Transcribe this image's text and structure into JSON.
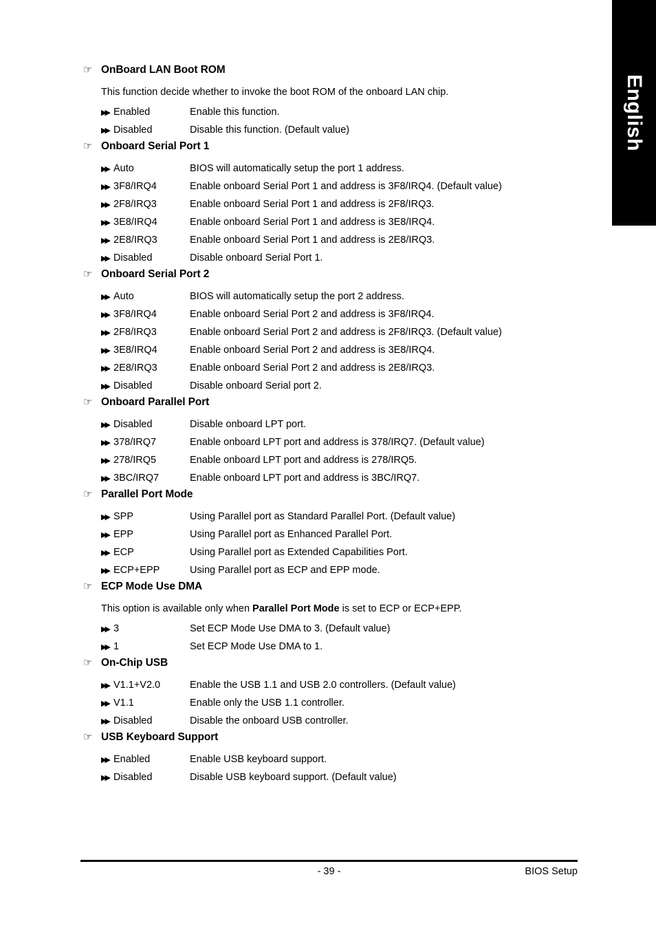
{
  "language_tab": {
    "label": "English"
  },
  "icons": {
    "section_marker": "☞",
    "option_marker": "▶▶"
  },
  "footer": {
    "page_number": "- 39 -",
    "document_name": "BIOS Setup"
  },
  "sections": [
    {
      "title": "OnBoard LAN Boot ROM",
      "note": "This function decide whether to invoke the boot ROM of the onboard LAN chip.",
      "note_bold": null,
      "options": [
        {
          "key": "Enabled",
          "desc": "Enable this function."
        },
        {
          "key": "Disabled",
          "desc": "Disable this function. (Default value)"
        }
      ]
    },
    {
      "title": "Onboard Serial Port 1",
      "note": null,
      "options": [
        {
          "key": "Auto",
          "desc": "BIOS will automatically setup the port 1 address."
        },
        {
          "key": "3F8/IRQ4",
          "desc": "Enable onboard Serial Port 1 and address is 3F8/IRQ4. (Default value)"
        },
        {
          "key": "2F8/IRQ3",
          "desc": "Enable onboard Serial Port 1 and address is 2F8/IRQ3."
        },
        {
          "key": "3E8/IRQ4",
          "desc": "Enable onboard Serial Port 1 and address is 3E8/IRQ4."
        },
        {
          "key": "2E8/IRQ3",
          "desc": "Enable onboard Serial Port 1 and address is 2E8/IRQ3."
        },
        {
          "key": "Disabled",
          "desc": "Disable onboard Serial Port 1."
        }
      ]
    },
    {
      "title": "Onboard Serial Port 2",
      "note": null,
      "options": [
        {
          "key": "Auto",
          "desc": "BIOS will automatically setup the port 2 address."
        },
        {
          "key": "3F8/IRQ4",
          "desc": "Enable onboard Serial Port 2 and address is 3F8/IRQ4."
        },
        {
          "key": "2F8/IRQ3",
          "desc": "Enable onboard Serial Port 2 and address is 2F8/IRQ3. (Default value)"
        },
        {
          "key": "3E8/IRQ4",
          "desc": "Enable onboard Serial Port 2 and address is 3E8/IRQ4."
        },
        {
          "key": "2E8/IRQ3",
          "desc": "Enable onboard Serial Port 2 and address is 2E8/IRQ3."
        },
        {
          "key": "Disabled",
          "desc": "Disable onboard Serial port 2."
        }
      ]
    },
    {
      "title": "Onboard Parallel Port",
      "note": null,
      "options": [
        {
          "key": "Disabled",
          "desc": "Disable onboard LPT port."
        },
        {
          "key": "378/IRQ7",
          "desc": "Enable onboard LPT port and address is 378/IRQ7. (Default value)"
        },
        {
          "key": "278/IRQ5",
          "desc": "Enable onboard LPT port and address is 278/IRQ5."
        },
        {
          "key": "3BC/IRQ7",
          "desc": "Enable onboard LPT port and address is 3BC/IRQ7."
        }
      ]
    },
    {
      "title": "Parallel Port Mode",
      "note": null,
      "options": [
        {
          "key": "SPP",
          "desc": "Using Parallel port as Standard Parallel Port. (Default value)"
        },
        {
          "key": "EPP",
          "desc": "Using Parallel port as Enhanced Parallel Port."
        },
        {
          "key": "ECP",
          "desc": "Using Parallel port as Extended Capabilities Port."
        },
        {
          "key": "ECP+EPP",
          "desc": "Using Parallel port as ECP and EPP mode."
        }
      ]
    },
    {
      "title": "ECP Mode Use DMA",
      "note_pre": "This option is available only when ",
      "note_bold": "Parallel Port Mode",
      "note_post": " is set to ECP or ECP+EPP.",
      "options": [
        {
          "key": "3",
          "desc": "Set ECP Mode Use DMA to 3. (Default value)"
        },
        {
          "key": "1",
          "desc": "Set ECP Mode Use DMA to 1."
        }
      ]
    },
    {
      "title": "On-Chip USB",
      "note": null,
      "options": [
        {
          "key": "V1.1+V2.0",
          "desc": "Enable the USB 1.1 and USB 2.0 controllers. (Default value)"
        },
        {
          "key": "V1.1",
          "desc": "Enable only the USB 1.1 controller."
        },
        {
          "key": "Disabled",
          "desc": "Disable the onboard USB controller."
        }
      ]
    },
    {
      "title": "USB Keyboard Support",
      "note": null,
      "options": [
        {
          "key": "Enabled",
          "desc": "Enable USB keyboard support."
        },
        {
          "key": "Disabled",
          "desc": "Disable USB keyboard support. (Default value)"
        }
      ]
    }
  ]
}
